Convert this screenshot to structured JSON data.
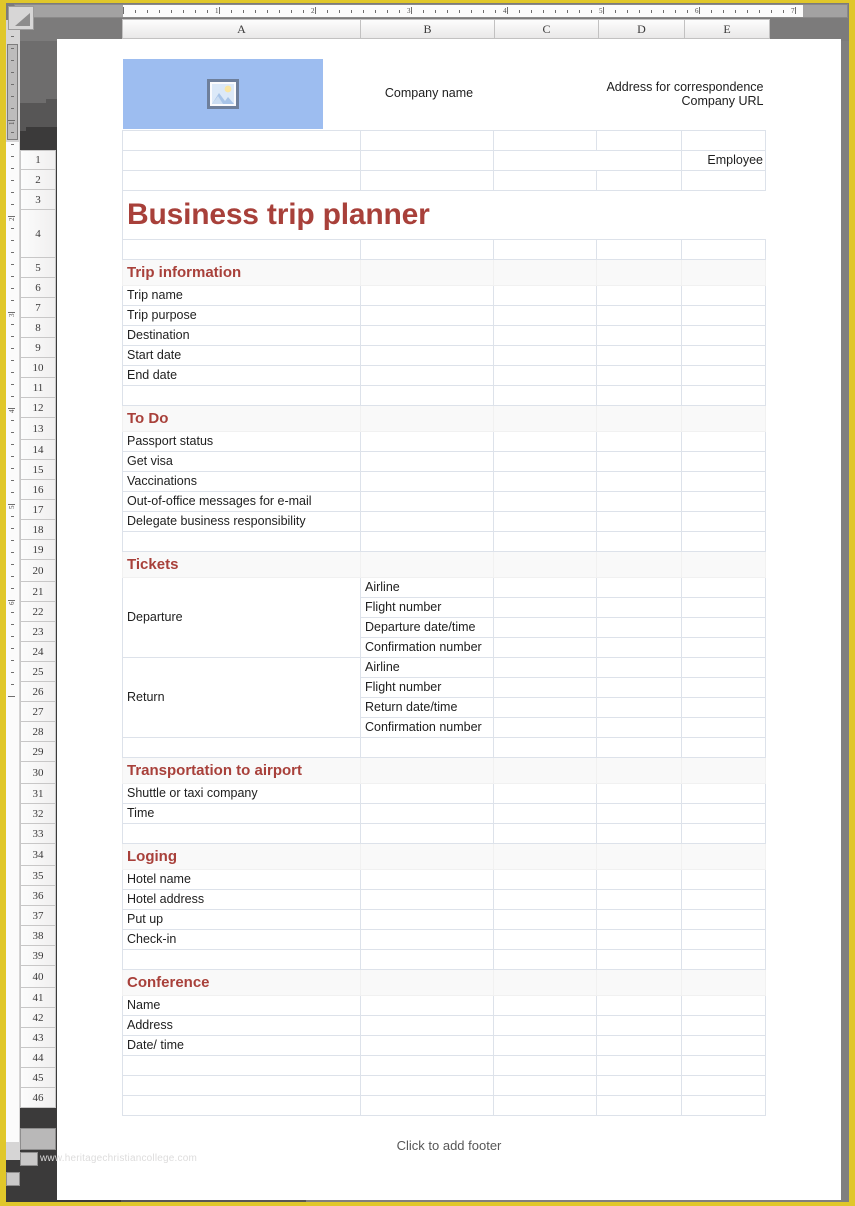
{
  "app": {
    "type": "spreadsheet",
    "accent_color": "#A8403A",
    "logo_bg_color": "#9DBDF0",
    "frame_color": "#E0C72A"
  },
  "column_headers": [
    "A",
    "B",
    "C",
    "D",
    "E"
  ],
  "row_headers": [
    "1",
    "2",
    "3",
    "4",
    "5",
    "6",
    "7",
    "8",
    "9",
    "10",
    "11",
    "12",
    "13",
    "14",
    "15",
    "16",
    "17",
    "18",
    "19",
    "20",
    "21",
    "22",
    "23",
    "24",
    "25",
    "26",
    "27",
    "28",
    "29",
    "30",
    "31",
    "32",
    "33",
    "34",
    "35",
    "36",
    "37",
    "38",
    "39",
    "40",
    "41",
    "42",
    "43",
    "44",
    "45",
    "46"
  ],
  "ruler": {
    "horizontal_numbers": [
      "1",
      "2",
      "3",
      "4",
      "5",
      "6",
      "7"
    ],
    "vertical_numbers": [
      "1",
      "2",
      "3",
      "4",
      "5",
      "6"
    ]
  },
  "letterhead": {
    "logo_icon": "picture-placeholder-icon",
    "company_name": "Company name",
    "address_label": "Address for correspondence",
    "url_label": "Company URL",
    "employee_label": "Employee"
  },
  "title": "Business trip planner",
  "sections": [
    {
      "name": "trip-information",
      "heading": "Trip information",
      "rows": [
        "Trip name",
        "Trip purpose",
        "Destination",
        "Start date",
        "End date"
      ]
    },
    {
      "name": "to-do",
      "heading": "To Do",
      "rows": [
        "Passport status",
        "Get visa",
        "Vaccinations",
        "Out-of-office messages for e-mail",
        "Delegate business responsibility"
      ]
    },
    {
      "name": "tickets",
      "heading": "Tickets",
      "groups": [
        {
          "label": "Departure",
          "rows": [
            "Airline",
            "Flight number",
            "Departure date/time",
            "Confirmation number"
          ]
        },
        {
          "label": "Return",
          "rows": [
            "Airline",
            "Flight number",
            "Return date/time",
            "Confirmation number"
          ]
        }
      ]
    },
    {
      "name": "transportation-to-airport",
      "heading": "Transportation to airport",
      "rows": [
        "Shuttle or taxi company",
        "Time"
      ]
    },
    {
      "name": "loging",
      "heading": "Loging",
      "rows": [
        "Hotel name",
        "Hotel address",
        "Put up",
        "Check-in"
      ]
    },
    {
      "name": "conference",
      "heading": "Conference",
      "rows": [
        "Name",
        "Address",
        "Date/ time"
      ]
    }
  ],
  "footer": {
    "placeholder": "Click to add footer",
    "watermark": "www.heritagechristiancollege.com"
  }
}
